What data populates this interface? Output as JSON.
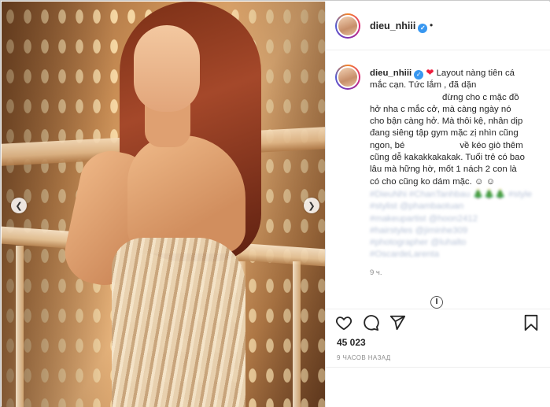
{
  "post": {
    "username": "dieu_nhiii",
    "verified": true,
    "caption_username": "dieu_nhiii",
    "caption_lines": [
      "Layout nàng tiên cá",
      "mắc cạn. Tức lắm , đã dặn",
      "đừng cho c mặc đồ",
      "hở nha c mắc cở, mà càng ngày nó",
      "cho bận càng hở. Mà thôi kệ, nhân dịp",
      "đang siêng tập gym mặc zị nhìn cũng",
      "ngon, bé",
      "về kéo giò thêm",
      "cũng dễ kakakkakakak. Tuổi trẻ có bao",
      "lâu mà hững hờ, mốt 1 nách 2 con là",
      "có cho cũng ko dám mặc. ☺ ☺"
    ],
    "hashtags": [
      "#DieuNhi #ChanTanhbau 🎄🎄🎄 #style",
      "#stylist @phambaotuan",
      "#makeupartist @hoon2412",
      "#hairstyles @jiminhe309",
      "#photographer @luhalto",
      "#OscardeLarenta"
    ],
    "caption_time": "9 ч.",
    "likes": "45 023",
    "timestamp": "9 ЧАСОВ НАЗАД"
  },
  "icons": {
    "prev": "chevron-left-icon",
    "next": "chevron-right-icon",
    "like": "heart-icon",
    "comment": "comment-icon",
    "share": "share-icon",
    "save": "bookmark-icon"
  },
  "colors": {
    "verified": "#3897f0",
    "heart": "#ed1c3c",
    "text": "#262626",
    "muted": "#8e8e8e"
  }
}
